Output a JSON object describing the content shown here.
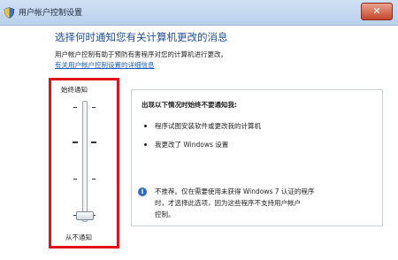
{
  "window": {
    "title": "用户帐户控制设置",
    "close_glyph": "✕"
  },
  "main": {
    "heading": "选择何时通知您有关计算机更改的消息",
    "description": "用户帐户控制有助于预防有害程序对您的计算机进行更改。",
    "link": "有关用户帐户控制设置的详细信息"
  },
  "slider": {
    "top_label": "始终通知",
    "bottom_label": "从不通知",
    "level": 0,
    "level_count": 4
  },
  "info": {
    "title": "出现以下情况时始终不要通知我:",
    "bullets": [
      "程序试图安装软件或更改我的计算机",
      "我更改了 Windows 设置"
    ],
    "note_icon": "info-icon",
    "note_lines": [
      "不推荐。仅在需要使用未获得 Windows 7 认证的程序",
      "时，才选择此选项，因为这些程序不支持用户帐户",
      "控制。"
    ]
  },
  "colors": {
    "heading": "#1e4e9a",
    "link": "#1a5dbd",
    "highlight_box": "#e0121a",
    "info_icon": "#2d6cc6"
  }
}
